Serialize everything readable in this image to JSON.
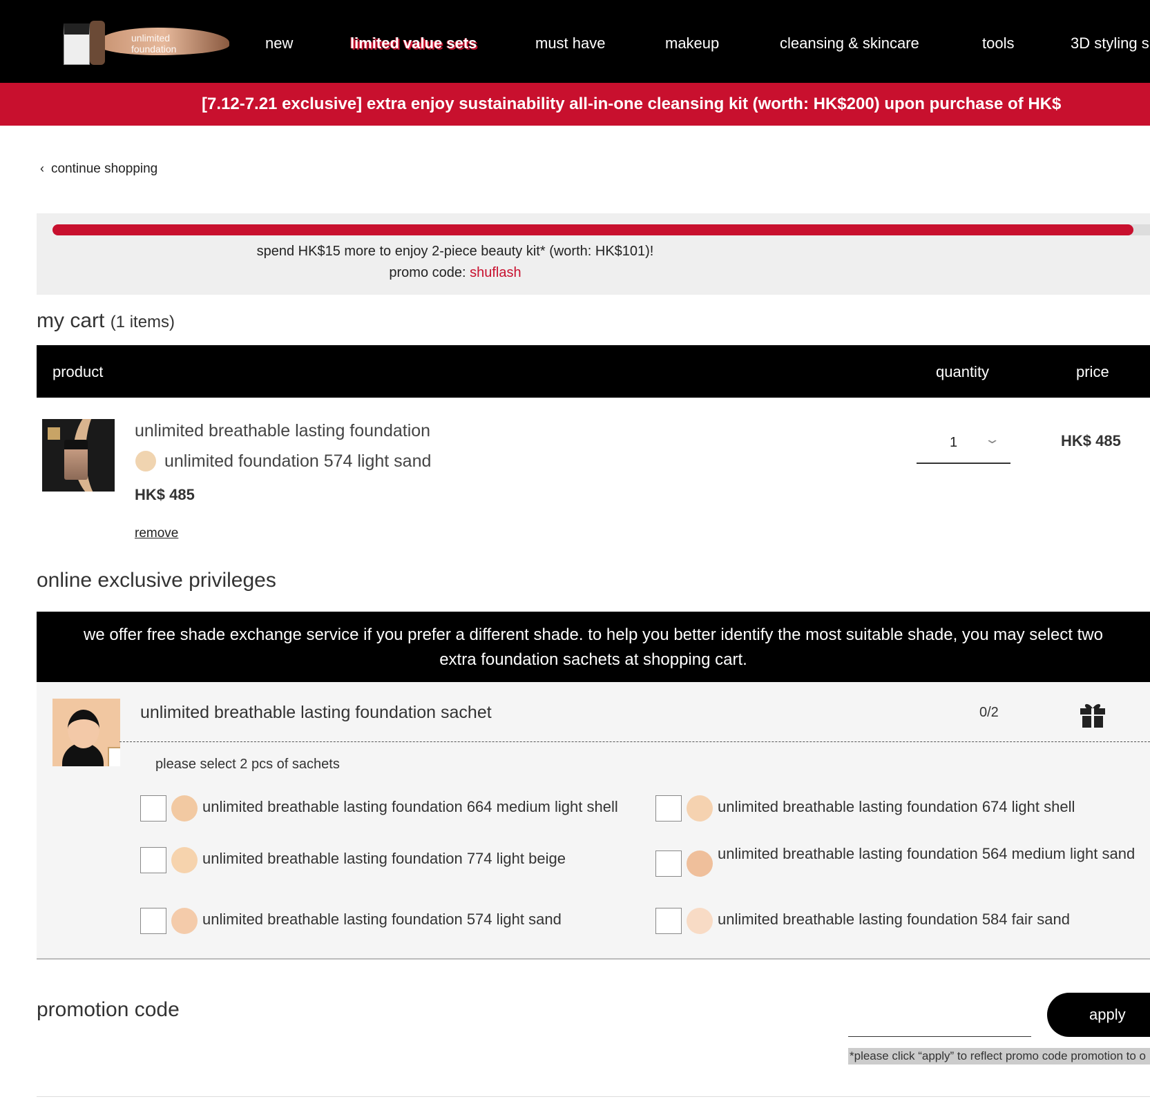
{
  "nav": {
    "logo_text_line1": "unlimited",
    "logo_text_line2": "foundation",
    "items": [
      "new",
      "limited value sets",
      "must have",
      "makeup",
      "cleansing & skincare",
      "tools",
      "3D styling s"
    ]
  },
  "banner": {
    "text": "[7.12-7.21 exclusive] extra enjoy sustainability all-in-one cleansing kit (worth: HK$200) upon purchase of HK$"
  },
  "continue_shopping": "continue shopping",
  "progress": {
    "fraction": 0.985,
    "message": "spend HK$15 more to enjoy 2-piece beauty kit* (worth: HK$101)!",
    "promo_label": "promo code: ",
    "promo_code": "shuflash"
  },
  "cart": {
    "title": "my cart",
    "count_label": "(1 items)",
    "headers": {
      "product": "product",
      "quantity": "quantity",
      "price": "price"
    },
    "item": {
      "name": "unlimited breathable lasting foundation",
      "shade": "unlimited foundation 574 light sand",
      "shade_color": "#f0d4b0",
      "unit_price": "HK$ 485",
      "remove": "remove",
      "quantity": "1",
      "line_price": "HK$ 485"
    }
  },
  "privileges": {
    "title": "online exclusive privileges",
    "notice": "we offer free shade exchange service if you prefer a different shade. to help you better identify the most suitable shade, you may select two extra foundation sachets at shopping cart.",
    "sachet_name": "unlimited breathable lasting foundation sachet",
    "count": "0/2",
    "hint": "please select 2 pcs of sachets",
    "options": [
      {
        "label": "unlimited breathable lasting foundation 664 medium light shell",
        "color": "#f2c9a2"
      },
      {
        "label": "unlimited breathable lasting foundation 674 light shell",
        "color": "#f5d2b0"
      },
      {
        "label": "unlimited breathable lasting foundation 774 light beige",
        "color": "#f6d3ad"
      },
      {
        "label": "unlimited breathable lasting foundation 564 medium light sand",
        "color": "#efbf9b"
      },
      {
        "label": "unlimited breathable lasting foundation 574 light sand",
        "color": "#f4cbaa"
      },
      {
        "label": "unlimited breathable lasting foundation 584 fair sand",
        "color": "#f8dbc5"
      }
    ]
  },
  "promo": {
    "title": "promotion code",
    "input_value": "",
    "apply": "apply",
    "note": "*please click “apply” to reflect promo code promotion to o"
  }
}
